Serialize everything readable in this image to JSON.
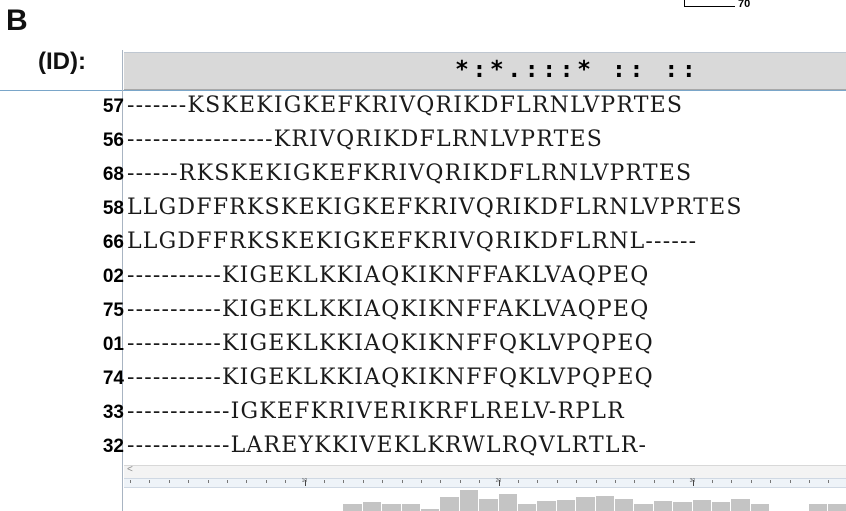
{
  "panel": {
    "letter": "B",
    "scale_label": "70",
    "id_header": "(ID):"
  },
  "alignment": {
    "consensus": "*:*.:::* :: ::",
    "rows": [
      {
        "id": "57",
        "seq": "-------KSKEKIGKEFKRIVQRIKDFLRNLVPRTES"
      },
      {
        "id": "56",
        "seq": "-----------------KRIVQRIKDFLRNLVPRTES"
      },
      {
        "id": "68",
        "seq": "------RKSKEKIGKEFKRIVQRIKDFLRNLVPRTES"
      },
      {
        "id": "58",
        "seq": "LLGDFFRKSKEKIGKEFKRIVQRIKDFLRNLVPRTES"
      },
      {
        "id": "66",
        "seq": "LLGDFFRKSKEKIGKEFKRIVQRIKDFLRNL------"
      },
      {
        "id": "02",
        "seq": "-----------KIGEKLKKIAQKIKNFFAKLVAQPEQ"
      },
      {
        "id": "75",
        "seq": "-----------KIGEKLKKIAQKIKNFFAKLVAQPEQ"
      },
      {
        "id": "01",
        "seq": "-----------KIGEKLKKIAQKIKNFFQKLVPQPEQ"
      },
      {
        "id": "74",
        "seq": "-----------KIGEKLKKIAQKIKNFFQKLVPQPEQ"
      },
      {
        "id": "33",
        "seq": "------------IGKEFKRIVERIKRFLRELV-RPLR"
      },
      {
        "id": "32",
        "seq": "------------LAREYKKIVEKLKRWLRQVLRTLR-"
      }
    ]
  },
  "ruler": {
    "labels": [
      "10",
      "20",
      "30"
    ]
  },
  "scroll": {
    "left_arrow": "<"
  },
  "conservation": {
    "levels": [
      0.0,
      0.0,
      0.0,
      0.0,
      0.0,
      0.0,
      0.0,
      0.0,
      0.0,
      0.0,
      0.0,
      0.3,
      0.35,
      0.3,
      0.3,
      0.1,
      0.55,
      0.85,
      0.5,
      0.7,
      0.3,
      0.4,
      0.45,
      0.55,
      0.6,
      0.5,
      0.3,
      0.4,
      0.35,
      0.45,
      0.35,
      0.5,
      0.3,
      0.0,
      0.0,
      0.3,
      0.3
    ]
  },
  "colors": {
    "header_bg": "#d9d9d9",
    "rule": "#7aa6c9",
    "hist": "#c4c4c4"
  }
}
